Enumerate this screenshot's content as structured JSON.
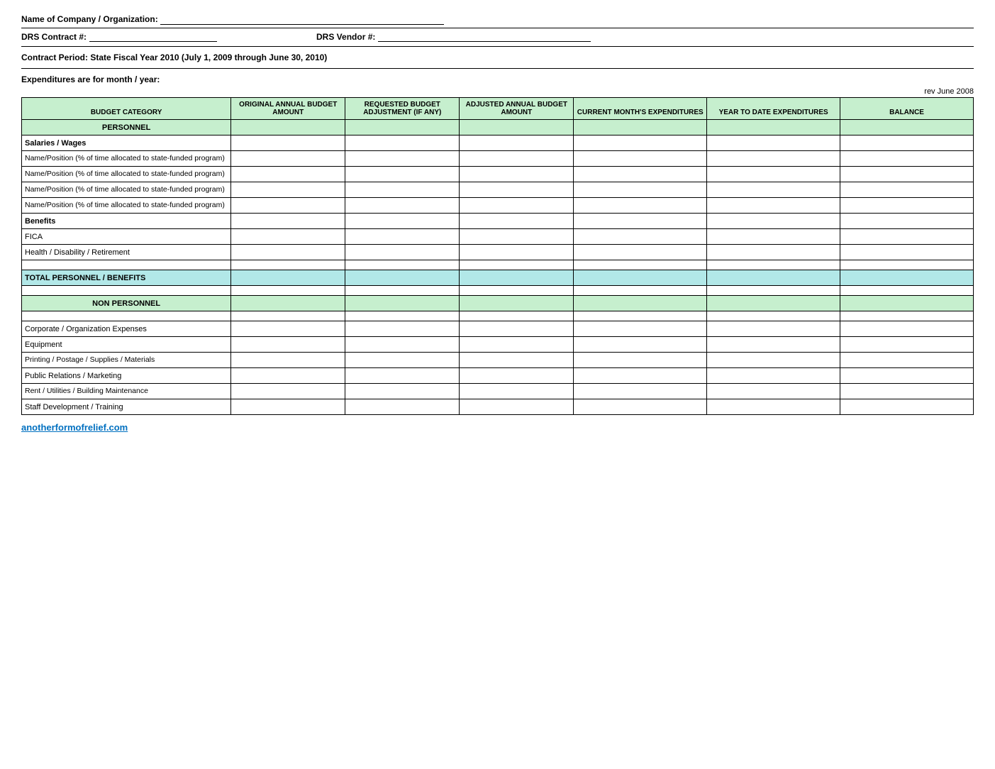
{
  "header": {
    "company_label": "Name of Company / Organization:",
    "contract_label": "DRS Contract #:",
    "vendor_label": "DRS Vendor #:",
    "contract_period": "Contract Period: State Fiscal Year 2010 (July 1, 2009 through June 30, 2010)",
    "expenditures_label": "Expenditures are for month / year:",
    "rev_note": "rev June 2008"
  },
  "columns": {
    "budget_category": "BUDGET CATEGORY",
    "original_annual_budget_amount": "ORIGINAL ANNUAL BUDGET AMOUNT",
    "requested_budget_adjustment": "REQUESTED BUDGET ADJUSTMENT (if any)",
    "adjusted_annual_budget_amount": "ADJUSTED ANNUAL BUDGET AMOUNT",
    "current_months_expenditures": "CURRENT MONTH'S EXPENDITURES",
    "year_to_date_expenditures": "YEAR TO DATE EXPENDITURES",
    "balance": "BALANCE"
  },
  "rows": {
    "personnel_header": "PERSONNEL",
    "salaries_wages": "Salaries / Wages",
    "name_position_1": "Name/Position (% of time allocated to state-funded program)",
    "name_position_2": "Name/Position (% of time allocated to state-funded program)",
    "name_position_3": "Name/Position (% of time allocated to state-funded program)",
    "name_position_4": "Name/Position (% of time allocated to state-funded program)",
    "benefits": "Benefits",
    "fica": "FICA",
    "health_disability": "Health / Disability / Retirement",
    "total_personnel": "TOTAL PERSONNEL / BENEFITS",
    "non_personnel": "NON PERSONNEL",
    "corporate_org": "Corporate / Organization Expenses",
    "equipment": "Equipment",
    "printing_postage": "Printing / Postage / Supplies / Materials",
    "public_relations": "Public Relations / Marketing",
    "rent_utilities": "Rent / Utilities / Building Maintenance",
    "staff_development": "Staff Development / Training"
  },
  "footer": {
    "link": "anotherformofrelief.com"
  }
}
